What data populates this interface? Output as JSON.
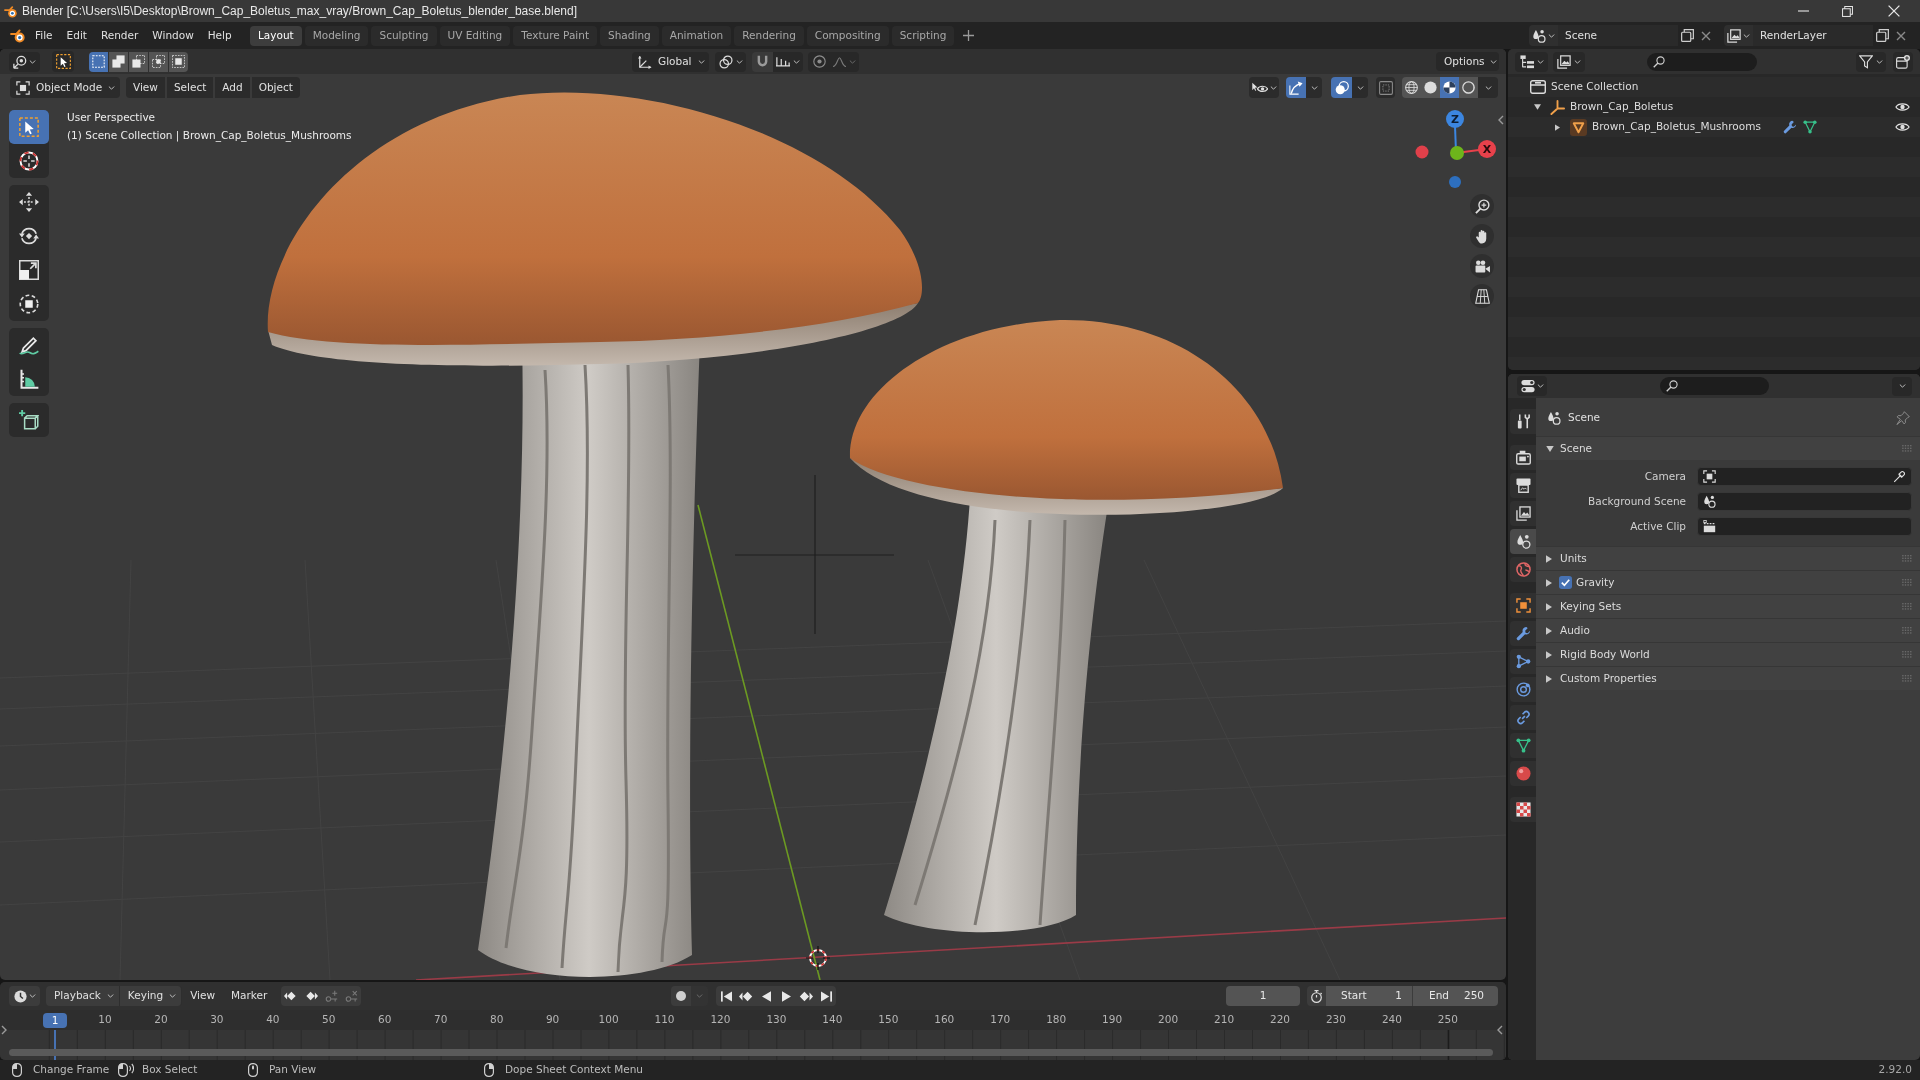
{
  "window": {
    "title": "Blender [C:\\Users\\I5\\Desktop\\Brown_Cap_Boletus_max_vray/Brown_Cap_Boletus_blender_base.blend]"
  },
  "menu_bar": {
    "items": [
      "File",
      "Edit",
      "Render",
      "Window",
      "Help"
    ]
  },
  "workspace_tabs": [
    {
      "label": "Layout",
      "selected": true
    },
    {
      "label": "Modeling",
      "selected": false
    },
    {
      "label": "Sculpting",
      "selected": false
    },
    {
      "label": "UV Editing",
      "selected": false
    },
    {
      "label": "Texture Paint",
      "selected": false
    },
    {
      "label": "Shading",
      "selected": false
    },
    {
      "label": "Animation",
      "selected": false
    },
    {
      "label": "Rendering",
      "selected": false
    },
    {
      "label": "Compositing",
      "selected": false
    },
    {
      "label": "Scripting",
      "selected": false
    }
  ],
  "scene_selector": {
    "value": "Scene"
  },
  "view_layer_selector": {
    "value": "RenderLayer"
  },
  "tool_header": {
    "select_modes": [
      {
        "kind": "set",
        "selected": true
      },
      {
        "kind": "extend",
        "selected": false
      },
      {
        "kind": "subtract",
        "selected": false
      },
      {
        "kind": "difference",
        "selected": false
      },
      {
        "kind": "intersect",
        "selected": false
      }
    ],
    "orientation": "Global",
    "options": "Options"
  },
  "viewport_header": {
    "mode": "Object Mode",
    "menus": [
      "View",
      "Select",
      "Add",
      "Object"
    ],
    "gizmos": {
      "on": true
    },
    "overlays": {
      "on": true
    },
    "xray": {
      "on": false
    },
    "shading_modes": [
      {
        "kind": "wireframe",
        "selected": false
      },
      {
        "kind": "solid",
        "selected": false
      },
      {
        "kind": "material",
        "selected": true
      },
      {
        "kind": "rendered",
        "selected": false
      }
    ]
  },
  "toolbar": {
    "groups": [
      {
        "tools": [
          {
            "kind": "select_box",
            "selected": true
          },
          {
            "kind": "cursor",
            "selected": false
          }
        ]
      },
      {
        "tools": [
          {
            "kind": "move",
            "selected": false
          },
          {
            "kind": "rotate",
            "selected": false
          },
          {
            "kind": "scale",
            "selected": false
          },
          {
            "kind": "transform",
            "selected": false
          }
        ]
      },
      {
        "tools": [
          {
            "kind": "annotate",
            "selected": false
          },
          {
            "kind": "measure",
            "selected": false
          }
        ]
      },
      {
        "tools": [
          {
            "kind": "add_cube",
            "selected": false
          }
        ]
      }
    ]
  },
  "viewport": {
    "overlay_lines": [
      "User Perspective",
      "(1) Scene Collection | Brown_Cap_Boletus_Mushrooms"
    ],
    "gizmo": {
      "z_label": "Z",
      "x_label": "X"
    }
  },
  "outliner": {
    "tree": [
      {
        "kind": "scene_collection",
        "name": "Scene Collection",
        "children": [
          {
            "kind": "empty",
            "name": "Brown_Cap_Boletus",
            "expanded": true,
            "visible": true,
            "children": [
              {
                "kind": "mesh_object",
                "name": "Brown_Cap_Boletus_Mushrooms",
                "expanded": false,
                "visible": true,
                "extras": [
                  {
                    "kind": "modifier"
                  },
                  {
                    "kind": "mesh"
                  }
                ]
              }
            ]
          }
        ]
      }
    ]
  },
  "properties": {
    "tab_groups": [
      {
        "tabs": [
          {
            "kind": "tool",
            "selected": false
          }
        ]
      },
      {
        "tabs": [
          {
            "kind": "render",
            "selected": false
          },
          {
            "kind": "output",
            "selected": false
          },
          {
            "kind": "view_layer",
            "selected": false
          },
          {
            "kind": "scene",
            "selected": true
          },
          {
            "kind": "world",
            "selected": false
          }
        ]
      },
      {
        "tabs": [
          {
            "kind": "object",
            "selected": false
          },
          {
            "kind": "modifiers",
            "selected": false
          },
          {
            "kind": "particles",
            "selected": false
          },
          {
            "kind": "physics",
            "selected": false
          },
          {
            "kind": "constraints",
            "selected": false
          },
          {
            "kind": "data",
            "selected": false
          },
          {
            "kind": "material",
            "selected": false
          }
        ]
      },
      {
        "tabs": [
          {
            "kind": "texture",
            "selected": false
          }
        ]
      }
    ],
    "context": "Scene",
    "panels": [
      {
        "kind": "plain",
        "title": "Scene",
        "expanded": true,
        "fields": [
          {
            "kind": "camera",
            "label": "Camera"
          },
          {
            "kind": "scene",
            "label": "Background Scene"
          },
          {
            "kind": "clip",
            "label": "Active Clip"
          }
        ]
      },
      {
        "kind": "plain",
        "title": "Units",
        "expanded": false
      },
      {
        "kind": "checkbox",
        "title": "Gravity",
        "expanded": false,
        "checked": true
      },
      {
        "kind": "plain",
        "title": "Keying Sets",
        "expanded": false
      },
      {
        "kind": "plain",
        "title": "Audio",
        "expanded": false
      },
      {
        "kind": "plain",
        "title": "Rigid Body World",
        "expanded": false
      },
      {
        "kind": "plain",
        "title": "Custom Properties",
        "expanded": false
      }
    ]
  },
  "timeline": {
    "menus": [
      {
        "kind": "dropdown",
        "label": "Playback"
      },
      {
        "kind": "dropdown",
        "label": "Keying"
      },
      {
        "kind": "menu",
        "label": "View"
      },
      {
        "kind": "menu",
        "label": "Marker"
      }
    ],
    "current_frame": "1",
    "start": {
      "label": "Start",
      "value": "1"
    },
    "end": {
      "label": "End",
      "value": "250"
    },
    "playhead": "1",
    "ruler": [
      "10",
      "20",
      "30",
      "40",
      "50",
      "60",
      "70",
      "80",
      "90",
      "100",
      "110",
      "120",
      "130",
      "140",
      "150",
      "160",
      "170",
      "180",
      "190",
      "200",
      "210",
      "220",
      "230",
      "240",
      "250"
    ]
  },
  "status_bar": {
    "hints": [
      {
        "kind": "left_click",
        "label": "Change Frame"
      },
      {
        "kind": "drag",
        "label": "Box Select"
      },
      {
        "kind": "middle_click",
        "label": "Pan View"
      },
      {
        "kind": "right_click",
        "label": "Dope Sheet Context Menu"
      }
    ],
    "version": "2.92.0"
  }
}
